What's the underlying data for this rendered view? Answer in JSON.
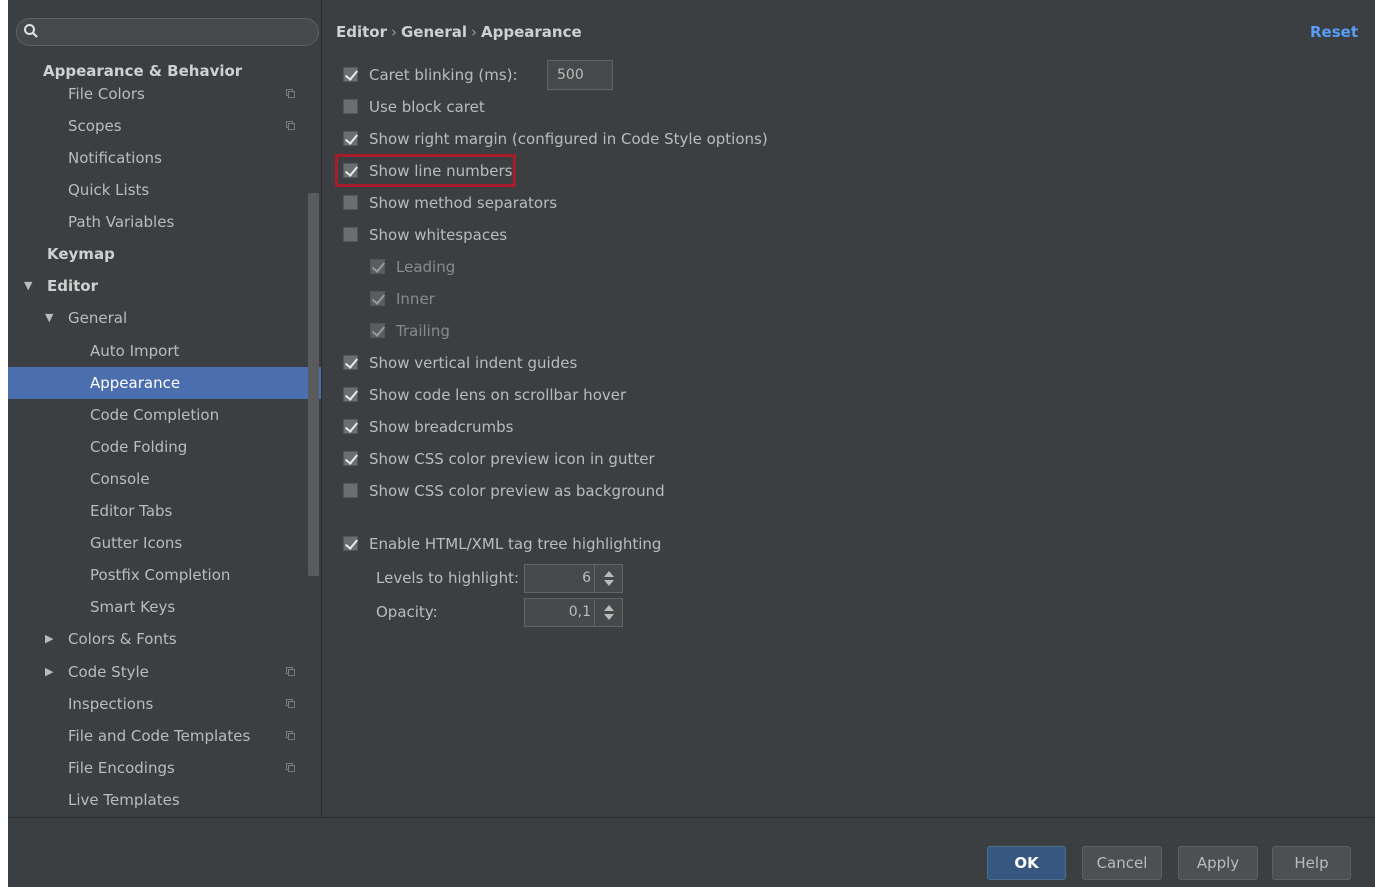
{
  "search": {
    "placeholder": ""
  },
  "sidebar": {
    "items": [
      {
        "label": "Appearance & Behavior",
        "bold": true
      },
      {
        "label": "File Colors",
        "copy": true
      },
      {
        "label": "Scopes",
        "copy": true
      },
      {
        "label": "Notifications"
      },
      {
        "label": "Quick Lists"
      },
      {
        "label": "Path Variables"
      },
      {
        "label": "Keymap",
        "bold": true
      },
      {
        "label": "Editor",
        "bold": true,
        "expanded": true
      },
      {
        "label": "General",
        "expanded": true
      },
      {
        "label": "Auto Import"
      },
      {
        "label": "Appearance",
        "selected": true
      },
      {
        "label": "Code Completion"
      },
      {
        "label": "Code Folding"
      },
      {
        "label": "Console"
      },
      {
        "label": "Editor Tabs"
      },
      {
        "label": "Gutter Icons"
      },
      {
        "label": "Postfix Completion"
      },
      {
        "label": "Smart Keys"
      },
      {
        "label": "Colors & Fonts",
        "collapsed": true
      },
      {
        "label": "Code Style",
        "collapsed": true,
        "copy": true
      },
      {
        "label": "Inspections",
        "copy": true
      },
      {
        "label": "File and Code Templates",
        "copy": true
      },
      {
        "label": "File Encodings",
        "copy": true
      },
      {
        "label": "Live Templates"
      }
    ]
  },
  "breadcrumb": {
    "part1": "Editor",
    "part2": "General",
    "part3": "Appearance",
    "separator": "›"
  },
  "reset_label": "Reset",
  "options": {
    "caret_blinking": {
      "label": "Caret blinking (ms):",
      "checked": true,
      "value": "500"
    },
    "block_caret": {
      "label": "Use block caret",
      "checked": false
    },
    "right_margin": {
      "label": "Show right margin (configured in Code Style options)",
      "checked": true
    },
    "line_numbers": {
      "label": "Show line numbers",
      "checked": true
    },
    "method_separators": {
      "label": "Show method separators",
      "checked": false
    },
    "whitespaces": {
      "label": "Show whitespaces",
      "checked": false
    },
    "leading": {
      "label": "Leading",
      "checked": true
    },
    "inner": {
      "label": "Inner",
      "checked": true
    },
    "trailing": {
      "label": "Trailing",
      "checked": true
    },
    "indent_guides": {
      "label": "Show vertical indent guides",
      "checked": true
    },
    "code_lens": {
      "label": "Show code lens on scrollbar hover",
      "checked": true
    },
    "breadcrumbs": {
      "label": "Show breadcrumbs",
      "checked": true
    },
    "css_gutter": {
      "label": "Show CSS color preview icon in gutter",
      "checked": true
    },
    "css_background": {
      "label": "Show CSS color preview as background",
      "checked": false
    },
    "tag_tree": {
      "label": "Enable HTML/XML tag tree highlighting",
      "checked": true
    }
  },
  "levels": {
    "label": "Levels to highlight:",
    "value": "6"
  },
  "opacity": {
    "label": "Opacity:",
    "value": "0,1"
  },
  "buttons": {
    "ok": "OK",
    "cancel": "Cancel",
    "apply": "Apply",
    "help": "Help"
  },
  "colors": {
    "background": "#3c3f41",
    "selection": "#4b6eaf",
    "link": "#589df6",
    "highlight": "#a51d2d",
    "default_button": "#365880"
  }
}
